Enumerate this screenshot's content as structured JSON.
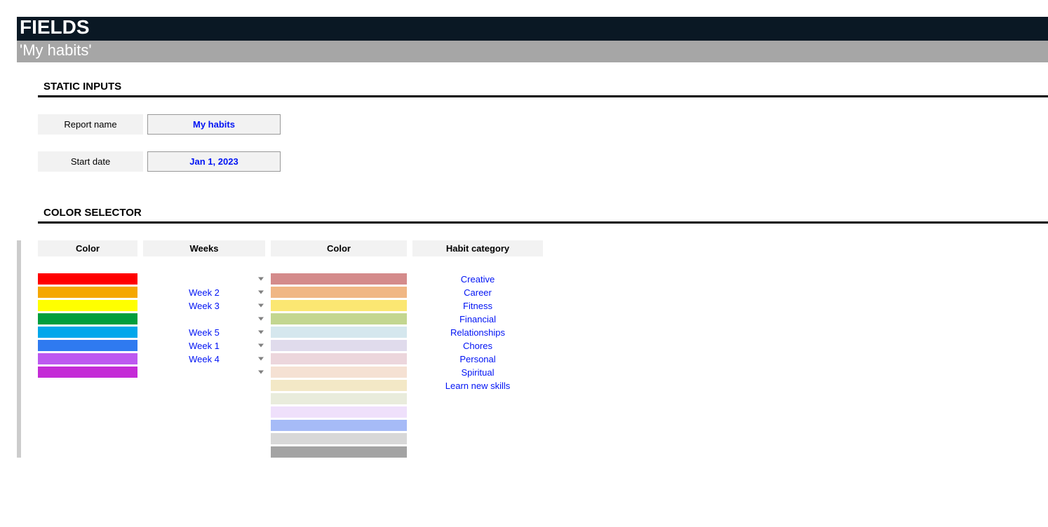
{
  "header": {
    "title": "FIELDS",
    "subtitle": "'My habits'"
  },
  "static_inputs": {
    "section_title": "STATIC INPUTS",
    "rows": [
      {
        "label": "Report name",
        "value": "My habits"
      },
      {
        "label": "Start date",
        "value": "Jan 1, 2023"
      }
    ]
  },
  "color_selector": {
    "section_title": "COLOR SELECTOR",
    "headers": {
      "col1": "Color",
      "col2": "Weeks",
      "col3": "Color",
      "col4": "Habit category"
    },
    "left_colors": [
      "#ff0000",
      "#f5a700",
      "#ffff00",
      "#009e3d",
      "#00a7eb",
      "#2f7af0",
      "#bd58f0",
      "#c42bd6"
    ],
    "weeks": [
      "",
      "Week 2",
      "Week 3",
      "",
      "Week 5",
      "Week 1",
      "Week 4",
      ""
    ],
    "right_colors": [
      "#d48b8b",
      "#f0b784",
      "#fbe772",
      "#c3d690",
      "#d5e7ee",
      "#e0dbec",
      "#ecd6dc",
      "#f5e1d3",
      "#f3e8c6",
      "#e9ecdc",
      "#efe0fb",
      "#a6bbf7",
      "#d8d8d8",
      "#a3a3a3"
    ],
    "habits": [
      "Creative",
      "Career",
      "Fitness",
      "Financial",
      "Relationships",
      "Chores",
      "Personal",
      "Spiritual",
      "Learn new skills"
    ]
  }
}
